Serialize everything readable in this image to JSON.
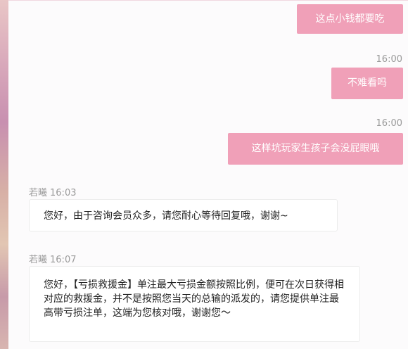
{
  "messages_out": [
    {
      "text": "这点小钱都要吃",
      "time": ""
    },
    {
      "text": "不难看吗",
      "time": "16:00"
    },
    {
      "text": "这样坑玩家生孩子会没屁眼哦",
      "time": "16:00"
    }
  ],
  "messages_in": [
    {
      "sender": "若曦",
      "time": "16:03",
      "text": "您好，由于咨询会员众多，请您耐心等待回复哦，谢谢~"
    },
    {
      "sender": "若曦",
      "time": "16:07",
      "text": "您好，【亏损救援金】单注最大亏损金额按照比例，便可在次日获得相对应的救援金，并不是按照您当天的总输的派发的，请您提供单注最高带亏损注单，这端为您核对哦，谢谢您～"
    }
  ],
  "colors": {
    "outgoing_bubble": "#f0a0b8",
    "incoming_bubble": "#ffffff",
    "timestamp": "#9a9a9a"
  }
}
